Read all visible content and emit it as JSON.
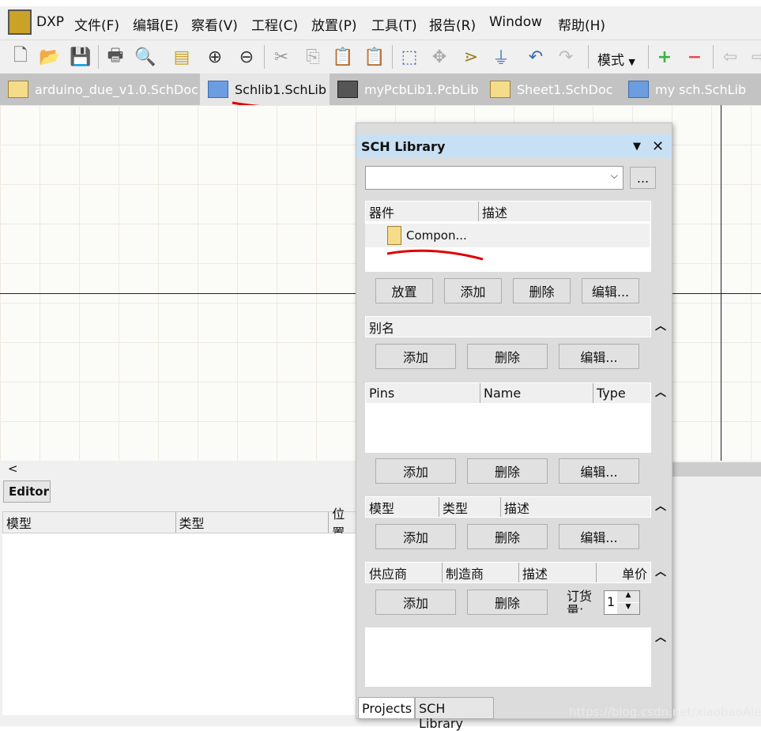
{
  "menu": {
    "logo": "DXP",
    "items": [
      "文件(F)",
      "编辑(E)",
      "察看(V)",
      "工程(C)",
      "放置(P)",
      "工具(T)",
      "报告(R)",
      "Window",
      "帮助(H)"
    ]
  },
  "toolbar": {
    "mode_label": "模式",
    "icons": [
      "new-icon",
      "open-icon",
      "save-icon",
      "print-icon",
      "preview-icon",
      "open-docs-icon",
      "zoom-in-icon",
      "zoom-out-icon",
      "cut-icon",
      "copy-icon",
      "paste-icon",
      "rubber-stamp-icon",
      "select-area-icon",
      "move-icon",
      "cross-select-icon",
      "clear-filter-icon",
      "undo-icon",
      "redo-icon",
      "add-icon",
      "remove-icon",
      "back-icon"
    ]
  },
  "tabs": [
    {
      "label": "arduino_due_v1.0.SchDoc",
      "icon": "schdoc"
    },
    {
      "label": "Schlib1.SchLib",
      "icon": "schlib",
      "active": true
    },
    {
      "label": "myPcbLib1.PcbLib",
      "icon": "pcblib"
    },
    {
      "label": "Sheet1.SchDoc",
      "icon": "schdoc"
    },
    {
      "label": "my sch.SchLib",
      "icon": "schlib"
    }
  ],
  "bottom": {
    "scroll_left": "<",
    "editor_tab": "Editor",
    "columns": [
      "模型",
      "类型",
      "位置"
    ]
  },
  "panel": {
    "title": "SCH Library",
    "filter_value": "",
    "browse": "...",
    "components": {
      "columns": [
        "器件",
        "描述"
      ],
      "rows": [
        {
          "name": "Compon...",
          "desc": ""
        }
      ]
    },
    "comp_buttons": [
      "放置",
      "添加",
      "删除",
      "编辑..."
    ],
    "aliases": {
      "columns": [
        "别名"
      ]
    },
    "alias_buttons": [
      "添加",
      "删除",
      "编辑..."
    ],
    "pins": {
      "columns": [
        "Pins",
        "Name",
        "Type"
      ]
    },
    "pin_buttons": [
      "添加",
      "删除",
      "编辑..."
    ],
    "models": {
      "columns": [
        "模型",
        "类型",
        "描述"
      ]
    },
    "model_buttons": [
      "添加",
      "删除",
      "编辑..."
    ],
    "suppliers": {
      "columns": [
        "供应商",
        "制造商",
        "描述",
        "单价"
      ]
    },
    "supplier_buttons": [
      "添加",
      "删除"
    ],
    "order_label": "订货量:",
    "order_qty": "1",
    "bottom_tabs": [
      "Projects",
      "SCH Library"
    ]
  },
  "watermark": "https://blog.csdn.net/xiaobaoAlex",
  "colors": {
    "panel_title": "#c8e0f4",
    "annotation": "#e00000"
  }
}
